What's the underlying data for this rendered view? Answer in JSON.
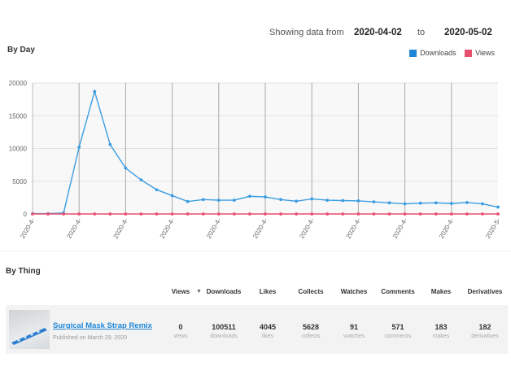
{
  "range": {
    "prefix": "Showing data from",
    "start": "2020-04-02",
    "mid": "to",
    "end": "2020-05-02"
  },
  "by_day": {
    "title": "By Day",
    "legend": {
      "downloads": "Downloads",
      "views": "Views"
    }
  },
  "colors": {
    "downloads": "#3b9de1",
    "views": "#e8506f"
  },
  "chart_data": {
    "type": "line",
    "title": "",
    "xlabel": "",
    "ylabel": "",
    "ylim": [
      0,
      20000
    ],
    "yticks": [
      "20000",
      "15000",
      "10000",
      "5000",
      "0"
    ],
    "xtick_labels": [
      "2020-4-",
      "2020-4-",
      "2020-4-",
      "2020-4-",
      "2020-4-",
      "2020-4-",
      "2020-4-",
      "2020-4-",
      "2020-4-",
      "2020-4-",
      "2020-5-"
    ],
    "grid": true,
    "legend": "top-right",
    "x": [
      1,
      2,
      3,
      4,
      5,
      6,
      7,
      8,
      9,
      10,
      11,
      12,
      13,
      14,
      15,
      16,
      17,
      18,
      19,
      20,
      21,
      22,
      23,
      24,
      25,
      26,
      27,
      28,
      29,
      30,
      31
    ],
    "series": [
      {
        "name": "Downloads",
        "values": [
          50,
          50,
          150,
          10200,
          18700,
          10600,
          7000,
          5200,
          3700,
          2800,
          1900,
          2200,
          2100,
          2100,
          2700,
          2600,
          2200,
          1950,
          2300,
          2100,
          2050,
          2000,
          1850,
          1700,
          1550,
          1650,
          1700,
          1600,
          1750,
          1550,
          1050
        ]
      },
      {
        "name": "Views",
        "values": [
          0,
          0,
          0,
          0,
          0,
          0,
          0,
          0,
          0,
          0,
          0,
          0,
          0,
          0,
          0,
          0,
          0,
          0,
          0,
          0,
          0,
          0,
          0,
          0,
          0,
          0,
          0,
          0,
          0,
          0,
          0
        ]
      }
    ]
  },
  "by_thing": {
    "title": "By Thing",
    "columns": [
      "Views",
      "Downloads",
      "Likes",
      "Collects",
      "Watches",
      "Comments",
      "Makes",
      "Derivatives"
    ],
    "item": {
      "name": "Surgical Mask Strap Remix",
      "published": "Published on March 29, 2020",
      "stats": [
        {
          "value": "0",
          "label": "views"
        },
        {
          "value": "100511",
          "label": "downloads"
        },
        {
          "value": "4045",
          "label": "likes"
        },
        {
          "value": "5628",
          "label": "collects"
        },
        {
          "value": "91",
          "label": "watches"
        },
        {
          "value": "571",
          "label": "comments"
        },
        {
          "value": "183",
          "label": "makes"
        },
        {
          "value": "182",
          "label": "derivatives"
        }
      ]
    }
  }
}
